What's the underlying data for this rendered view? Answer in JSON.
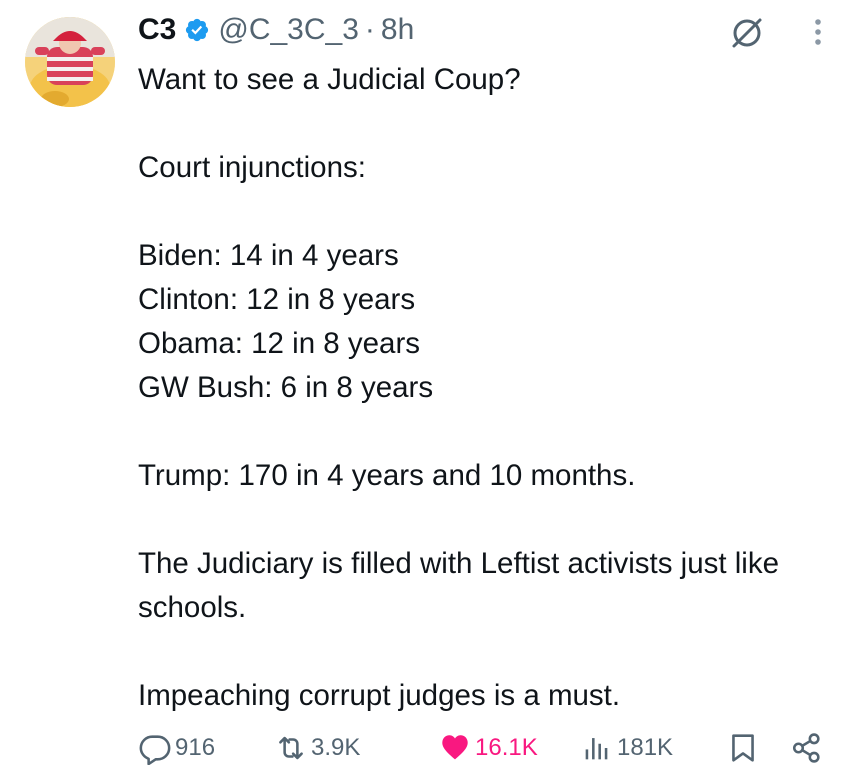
{
  "post": {
    "author_name": "C3",
    "handle": "@C_3C_3",
    "separator": "·",
    "time_ago": "8h",
    "verified": true,
    "text_paragraphs": [
      "Want to see a Judicial Coup?",
      "Court injunctions:",
      "Biden: 14 in 4 years\nClinton: 12 in 8 years\nObama: 12 in 8 years\nGW Bush: 6 in 8 years",
      "Trump: 170 in 4 years and 10 months.",
      "The Judiciary is filled with Leftist activists just like schools.",
      "Impeaching corrupt judges is a must."
    ]
  },
  "metrics": {
    "replies": "916",
    "reposts": "3.9K",
    "likes": "16.1K",
    "views": "181K"
  },
  "icons": {
    "verified": "verified-badge-icon",
    "grok": "grok-icon",
    "more": "more-vertical-icon",
    "reply": "reply-icon",
    "repost": "repost-icon",
    "like": "heart-icon",
    "views": "views-chart-icon",
    "bookmark": "bookmark-icon",
    "share": "share-icon"
  },
  "colors": {
    "text": "#0f1419",
    "secondary": "#536471",
    "verified_blue": "#1d9bf0",
    "like_pink": "#f91880"
  }
}
